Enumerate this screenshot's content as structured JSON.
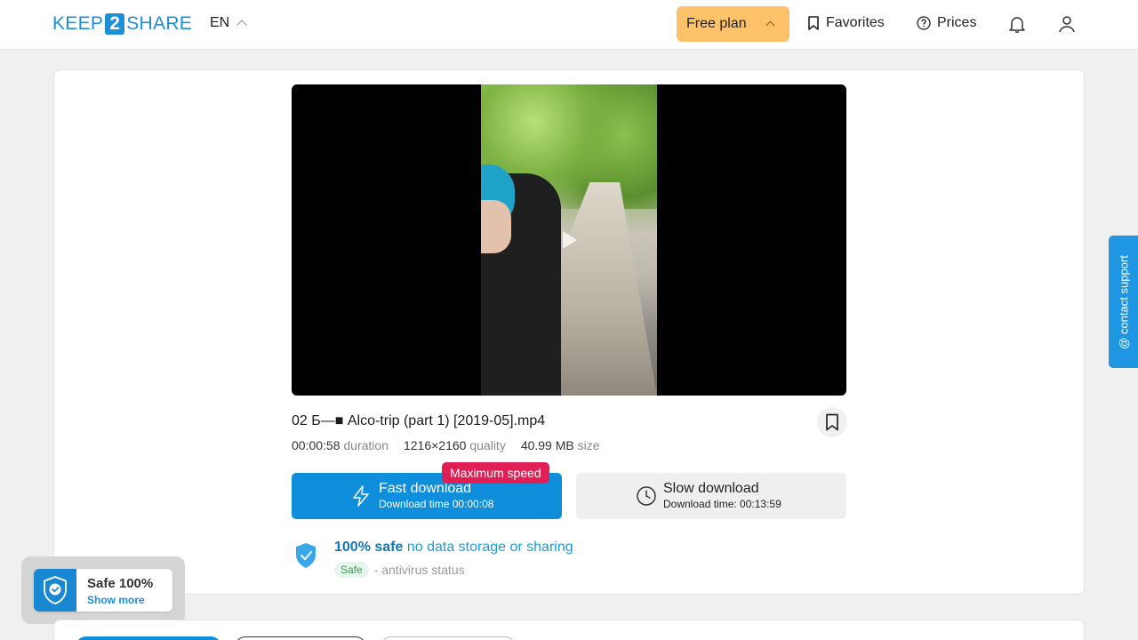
{
  "header": {
    "logo_left": "KEEP",
    "logo_mid": "2",
    "logo_right": "SHARE",
    "language": "EN",
    "plan_label": "Free plan",
    "favorites_label": "Favorites",
    "prices_label": "Prices"
  },
  "file": {
    "title": "02 Б—■ Alco-trip (part 1) [2019-05].mp4",
    "duration_value": "00:00:58",
    "duration_label": "duration",
    "quality_value": "1216×2160",
    "quality_label": "quality",
    "size_value": "40.99 MB",
    "size_label": "size"
  },
  "download": {
    "fast_title": "Fast download",
    "fast_time": "Download time 00:00:08",
    "badge": "Maximum speed",
    "slow_title": "Slow download",
    "slow_time": "Download time: 00:13:59"
  },
  "safety": {
    "safe_strong": "100% safe",
    "safe_rest": " no data storage or sharing",
    "chip": "Safe",
    "av_text": "- antivirus status"
  },
  "float_badge": {
    "title": "Safe 100%",
    "link": "Show more"
  },
  "support": {
    "label": "@ contact support"
  },
  "colors": {
    "primary": "#0f8fdb",
    "plan": "#fdc26a",
    "badge": "#e01f56"
  }
}
